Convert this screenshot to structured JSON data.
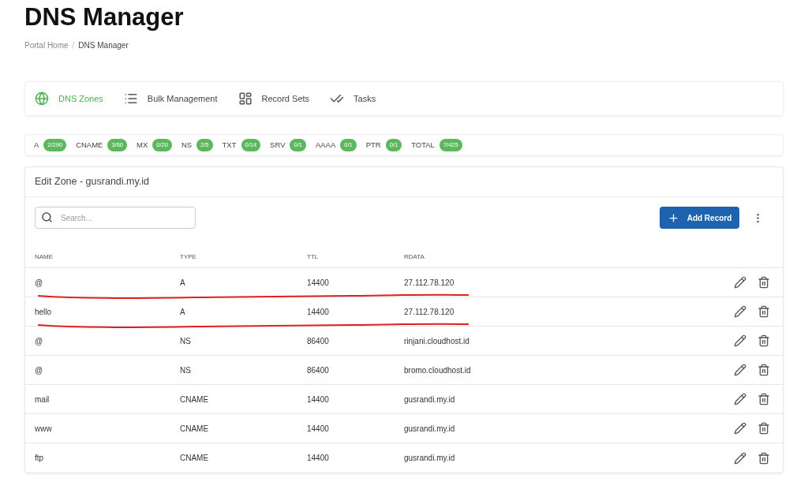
{
  "page_title": "DNS Manager",
  "breadcrumb_separator": "/",
  "breadcrumb": [
    {
      "label": "Portal Home",
      "current": false
    },
    {
      "label": "DNS Manager",
      "current": true
    }
  ],
  "tabs": [
    {
      "label": "DNS Zones",
      "kind": "globe",
      "selected": true
    },
    {
      "label": "Bulk Management",
      "kind": "list",
      "selected": false
    },
    {
      "label": "Record Sets",
      "kind": "grid",
      "selected": false
    },
    {
      "label": "Tasks",
      "kind": "checks",
      "selected": false
    }
  ],
  "record_counts": [
    {
      "type": "A",
      "count": "2/290"
    },
    {
      "type": "CNAME",
      "count": "3/60"
    },
    {
      "type": "MX",
      "count": "0/20"
    },
    {
      "type": "NS",
      "count": "2/5"
    },
    {
      "type": "TXT",
      "count": "0/14"
    },
    {
      "type": "SRV",
      "count": "0/1"
    },
    {
      "type": "AAAA",
      "count": "0/1"
    },
    {
      "type": "PTR",
      "count": "0/1"
    },
    {
      "type": "TOTAL",
      "count": "7/425"
    }
  ],
  "zone": {
    "title": "Edit Zone - gusrandi.my.id",
    "search": {
      "placeholder": "Search..."
    },
    "add_button": "Add Record",
    "columns": [
      "NAME",
      "TYPE",
      "TTL",
      "RDATA"
    ],
    "rows": [
      {
        "name": "@",
        "type": "A",
        "ttl": "14400",
        "rdata": "27.112.78.120",
        "underlined": true
      },
      {
        "name": "hello",
        "type": "A",
        "ttl": "14400",
        "rdata": "27.112.78.120",
        "underlined": true
      },
      {
        "name": "@",
        "type": "NS",
        "ttl": "86400",
        "rdata": "rinjani.cloudhost.id",
        "underlined": false
      },
      {
        "name": "@",
        "type": "NS",
        "ttl": "86400",
        "rdata": "bromo.cloudhost.id",
        "underlined": false
      },
      {
        "name": "mail",
        "type": "CNAME",
        "ttl": "14400",
        "rdata": "gusrandi.my.id",
        "underlined": false
      },
      {
        "name": "www",
        "type": "CNAME",
        "ttl": "14400",
        "rdata": "gusrandi.my.id",
        "underlined": false
      },
      {
        "name": "ftp",
        "type": "CNAME",
        "ttl": "14400",
        "rdata": "gusrandi.my.id",
        "underlined": false
      }
    ]
  }
}
